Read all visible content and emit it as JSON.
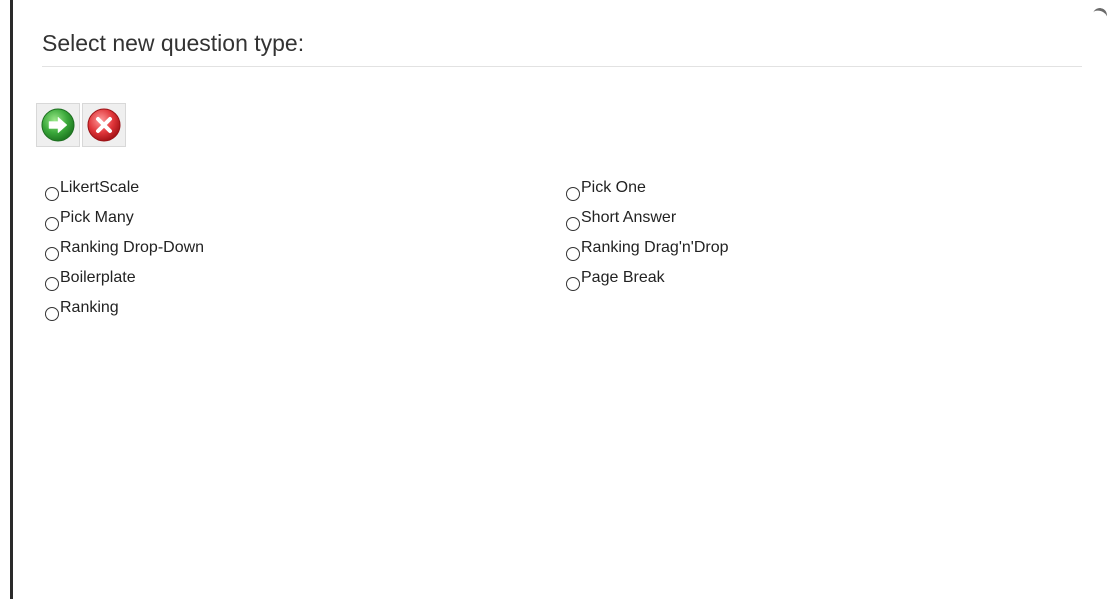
{
  "dialog": {
    "title": "Select new question type:"
  },
  "toolbar": {
    "buttons": [
      {
        "icon": "arrow-right-icon",
        "color": "#3aa83a"
      },
      {
        "icon": "close-icon",
        "color": "#d92b2b"
      }
    ]
  },
  "options": {
    "left": [
      {
        "label": "LikertScale",
        "selected": false
      },
      {
        "label": "Pick Many",
        "selected": false
      },
      {
        "label": "Ranking Drop-Down",
        "selected": false
      },
      {
        "label": "Boilerplate",
        "selected": false
      },
      {
        "label": "Ranking",
        "selected": false
      }
    ],
    "right": [
      {
        "label": "Pick One",
        "selected": false
      },
      {
        "label": "Short Answer",
        "selected": false
      },
      {
        "label": "Ranking Drag'n'Drop",
        "selected": false
      },
      {
        "label": "Page Break",
        "selected": false
      }
    ]
  }
}
